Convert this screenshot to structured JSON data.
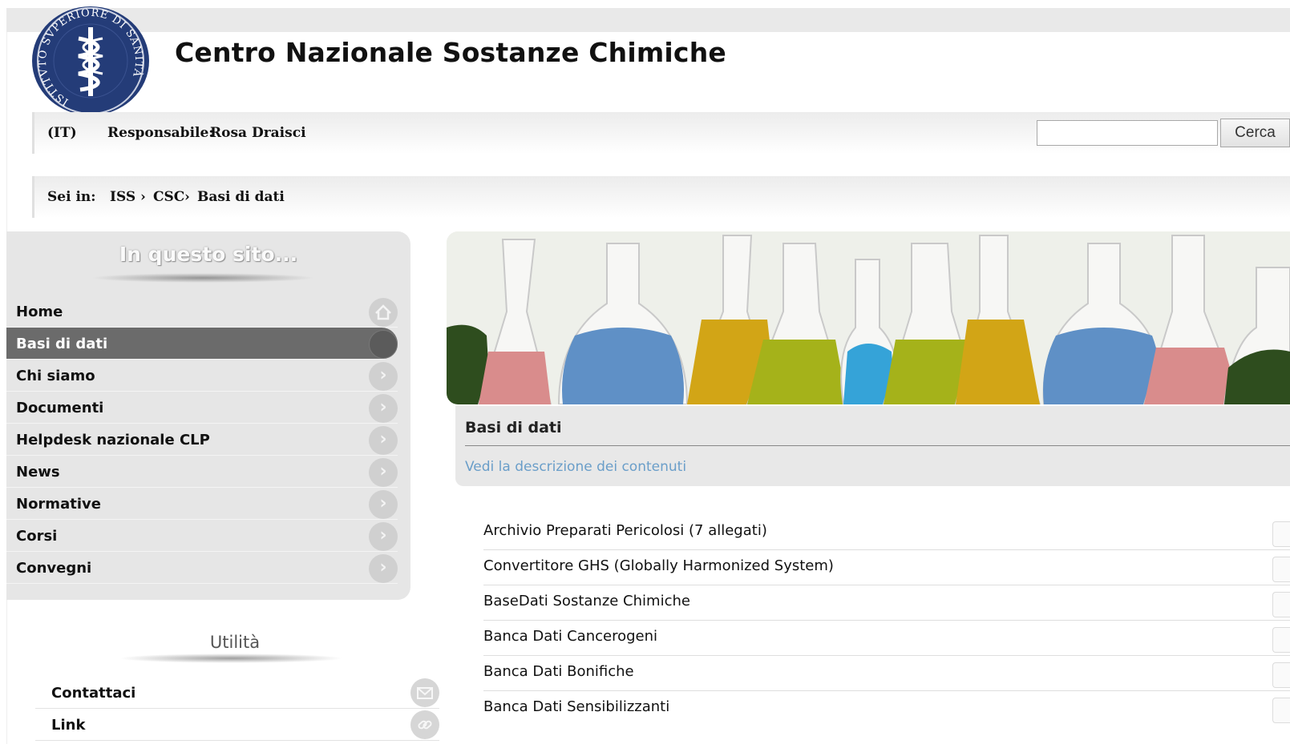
{
  "header": {
    "title": "Centro Nazionale Sostanze Chimiche",
    "logo_text": "ISTITVTO SVPERIORE DI SANITÀ"
  },
  "infobar": {
    "language": "(IT)",
    "responsabile_label": "Responsabile:",
    "responsabile_name": "Rosa Draisci",
    "search_placeholder": "",
    "search_button": "Cerca"
  },
  "breadcrumb": {
    "label": "Sei in:",
    "items": [
      "ISS",
      "CSC",
      "Basi di dati"
    ],
    "separator": "›"
  },
  "sidebar": {
    "heading": "In questo sito...",
    "items": [
      {
        "label": "Home",
        "icon": "home-icon"
      },
      {
        "label": "Basi di dati",
        "icon": "circle-icon",
        "active": true
      },
      {
        "label": "Chi siamo",
        "icon": "chevron-right-icon"
      },
      {
        "label": "Documenti",
        "icon": "chevron-right-icon"
      },
      {
        "label": "Helpdesk nazionale CLP",
        "icon": "chevron-right-icon"
      },
      {
        "label": "News",
        "icon": "chevron-right-icon"
      },
      {
        "label": "Normative",
        "icon": "chevron-right-icon"
      },
      {
        "label": "Corsi",
        "icon": "chevron-right-icon"
      },
      {
        "label": "Convegni",
        "icon": "chevron-right-icon"
      }
    ]
  },
  "utility": {
    "heading": "Utilità",
    "items": [
      {
        "label": "Contattaci",
        "icon": "mail-icon"
      },
      {
        "label": "Link",
        "icon": "link-icon"
      }
    ]
  },
  "content": {
    "title": "Basi di dati",
    "description_link": "Vedi la descrizione dei contenuti",
    "items": [
      "Archivio Preparati Pericolosi (7 allegati)",
      "Convertitore GHS (Globally Harmonized System)",
      "BaseDati Sostanze Chimiche",
      "Banca Dati Cancerogeni",
      "Banca Dati Bonifiche",
      "Banca Dati Sensibilizzanti"
    ]
  },
  "colors": {
    "link": "#1a237e",
    "active_nav": "#6b6b6b",
    "desc_link": "#6a9ec9",
    "logo": "#243c78"
  }
}
